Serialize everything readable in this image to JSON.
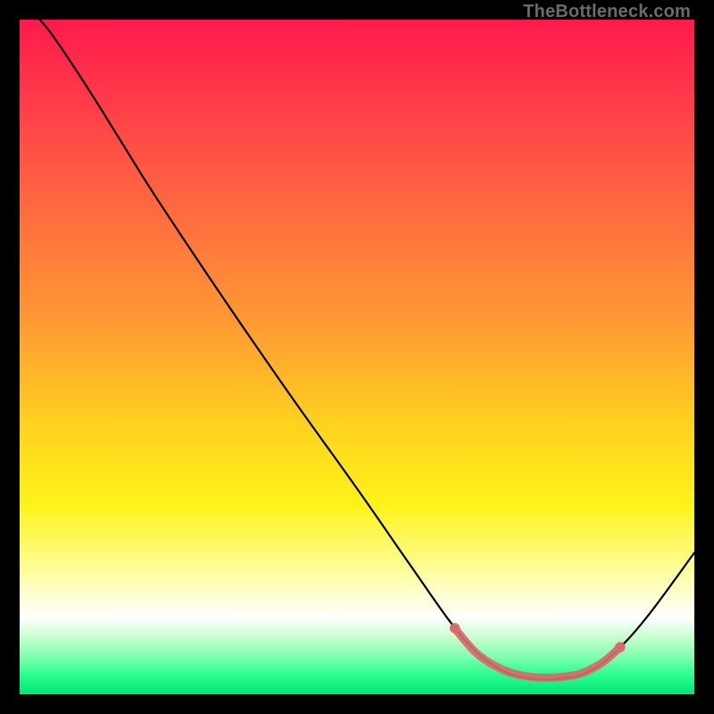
{
  "watermark": "TheBottleneck.com",
  "chart_data": {
    "type": "line",
    "title": "",
    "xlabel": "",
    "ylabel": "",
    "xlim": [
      0,
      100
    ],
    "ylim": [
      0,
      100
    ],
    "grid": false,
    "legend": false,
    "background_gradient_stops": [
      {
        "offset": 0.0,
        "color": "#ff1a4b"
      },
      {
        "offset": 0.12,
        "color": "#ff3b4a"
      },
      {
        "offset": 0.28,
        "color": "#ff6a3f"
      },
      {
        "offset": 0.45,
        "color": "#ff9a33"
      },
      {
        "offset": 0.6,
        "color": "#ffd21f"
      },
      {
        "offset": 0.72,
        "color": "#fff31a"
      },
      {
        "offset": 0.82,
        "color": "#fdffa0"
      },
      {
        "offset": 0.885,
        "color": "#ffffff"
      },
      {
        "offset": 0.915,
        "color": "#c7ffd0"
      },
      {
        "offset": 0.945,
        "color": "#7fffb0"
      },
      {
        "offset": 0.97,
        "color": "#2bff8f"
      },
      {
        "offset": 1.0,
        "color": "#00e676"
      }
    ],
    "series": [
      {
        "name": "bottleneck-curve",
        "stroke": "#000000",
        "stroke_width": 2.2,
        "points": [
          {
            "x": 3.0,
            "y": 100.0
          },
          {
            "x": 5.0,
            "y": 97.5
          },
          {
            "x": 10.0,
            "y": 90.0
          },
          {
            "x": 15.0,
            "y": 82.0
          },
          {
            "x": 20.0,
            "y": 74.0
          },
          {
            "x": 30.0,
            "y": 59.0
          },
          {
            "x": 40.0,
            "y": 44.5
          },
          {
            "x": 50.0,
            "y": 30.5
          },
          {
            "x": 58.0,
            "y": 19.0
          },
          {
            "x": 64.0,
            "y": 10.5
          },
          {
            "x": 68.0,
            "y": 6.0
          },
          {
            "x": 72.0,
            "y": 3.3
          },
          {
            "x": 76.0,
            "y": 2.3
          },
          {
            "x": 80.0,
            "y": 2.3
          },
          {
            "x": 84.0,
            "y": 3.2
          },
          {
            "x": 88.0,
            "y": 6.0
          },
          {
            "x": 93.0,
            "y": 11.5
          },
          {
            "x": 100.0,
            "y": 21.0
          }
        ]
      },
      {
        "name": "optimal-range-highlight",
        "stroke": "#d86a6a",
        "stroke_width": 9,
        "linecap": "round",
        "points": [
          {
            "x": 64.5,
            "y": 9.8
          },
          {
            "x": 67.5,
            "y": 6.3
          },
          {
            "x": 70.5,
            "y": 4.2
          },
          {
            "x": 73.5,
            "y": 3.0
          },
          {
            "x": 77.0,
            "y": 2.5
          },
          {
            "x": 80.5,
            "y": 2.6
          },
          {
            "x": 83.5,
            "y": 3.2
          },
          {
            "x": 86.5,
            "y": 4.8
          },
          {
            "x": 89.0,
            "y": 7.0
          }
        ]
      }
    ]
  }
}
